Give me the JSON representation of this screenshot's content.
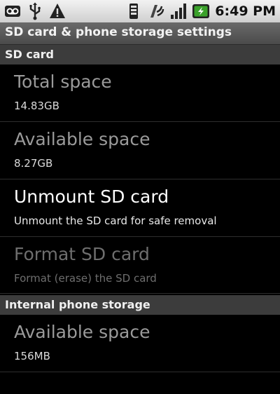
{
  "status_bar": {
    "time": "6:49 PM",
    "icons_left": [
      "voicemail-icon",
      "usb-icon",
      "warning-icon"
    ],
    "icons_right": [
      "vibrate-icon",
      "signal-wave-icon",
      "signal-strength-icon",
      "battery-charging-icon"
    ]
  },
  "title": "SD card & phone storage settings",
  "sections": [
    {
      "header": "SD card",
      "items": [
        {
          "title": "Total space",
          "summary": "14.83GB",
          "state": "static"
        },
        {
          "title": "Available space",
          "summary": "8.27GB",
          "state": "static"
        },
        {
          "title": "Unmount SD card",
          "summary": "Unmount the SD card for safe removal",
          "state": "enabled"
        },
        {
          "title": "Format SD card",
          "summary": "Format (erase) the SD card",
          "state": "disabled"
        }
      ]
    },
    {
      "header": "Internal phone storage",
      "items": [
        {
          "title": "Available space",
          "summary": "156MB",
          "state": "static"
        }
      ]
    }
  ],
  "colors": {
    "status_bar": "#e0e0e0",
    "title_bar": "#5a5a5a",
    "section_header": "#3c3c3c",
    "battery_green": "#3aa12a"
  }
}
